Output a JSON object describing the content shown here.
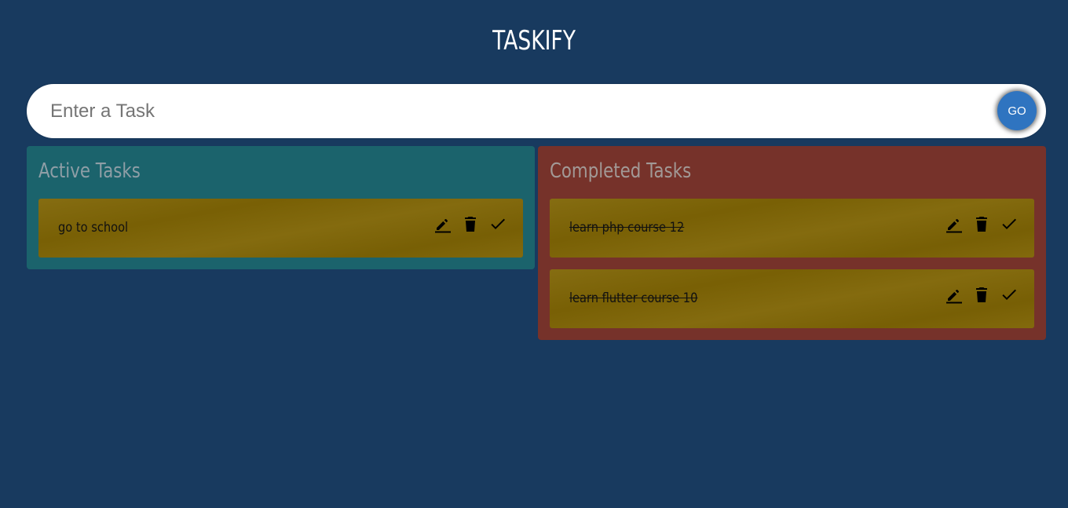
{
  "app": {
    "title": "TASKIFY"
  },
  "input": {
    "placeholder": "Enter a Task",
    "value": "",
    "submit_label": "GO"
  },
  "active_panel": {
    "heading": "Active Tasks",
    "tasks": [
      {
        "text": "go to school",
        "done": false
      }
    ]
  },
  "completed_panel": {
    "heading": "Completed Tasks",
    "tasks": [
      {
        "text": "learn php course 12",
        "done": true
      },
      {
        "text": "learn flutter course 10",
        "done": true
      }
    ]
  },
  "task_action_icons": [
    "edit-icon",
    "delete-icon",
    "done-check-icon"
  ],
  "colors": {
    "background": "#183a5f",
    "active_panel": "#1b636c",
    "completed_panel": "#76322a",
    "task_card": "#7f6505",
    "go_button": "#2f74c0"
  }
}
